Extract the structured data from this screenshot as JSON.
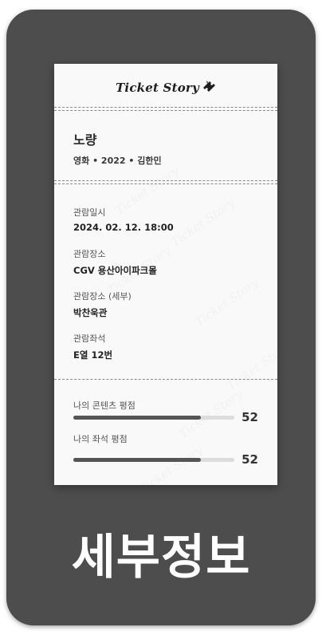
{
  "brand": {
    "logo_text": "Ticket Story",
    "logo_icon": "ticket-icon",
    "watermark_text": "Ticket Story"
  },
  "movie": {
    "title": "노량",
    "meta": "영화 • 2022 • 김한민"
  },
  "details": [
    {
      "label": "관람일시",
      "value": "2024. 02. 12. 18:00"
    },
    {
      "label": "관람장소",
      "value": "CGV 용산아이파크몰"
    },
    {
      "label": "관람장소 (세부)",
      "value": "박찬욱관"
    },
    {
      "label": "관람좌석",
      "value": "E열 12번"
    }
  ],
  "ratings": [
    {
      "label": "나의 콘텐츠 평점",
      "value": "52",
      "fill_fraction": 0.79
    },
    {
      "label": "나의 좌석 평점",
      "value": "52",
      "fill_fraction": 0.79
    }
  ],
  "caption": "세부정보",
  "colors": {
    "frame": "#4d4d4d",
    "ticket": "#f9f9f9",
    "bar_fill": "#555555",
    "bar_track": "#dcdcdc"
  }
}
